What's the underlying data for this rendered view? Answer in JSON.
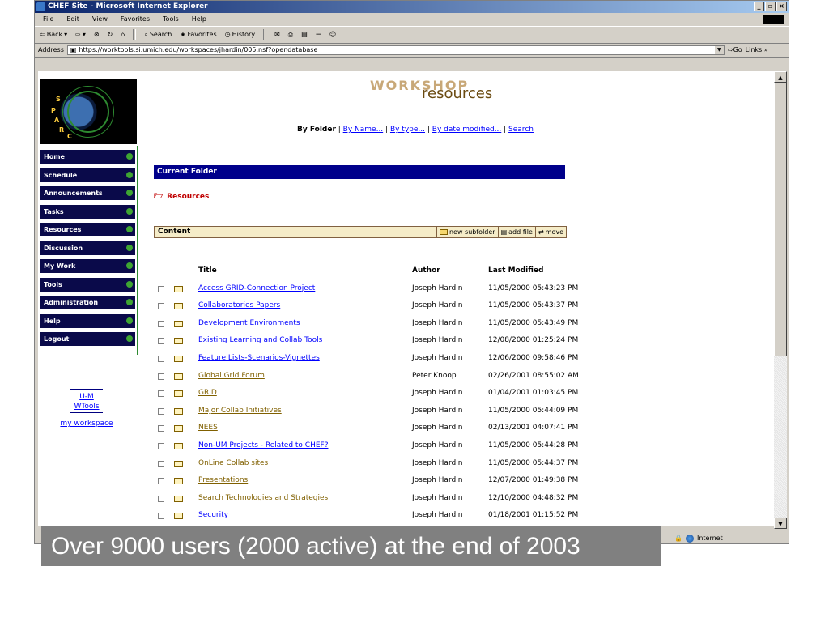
{
  "window": {
    "title": "CHEF Site - Microsoft Internet Explorer"
  },
  "menu": [
    "File",
    "Edit",
    "View",
    "Favorites",
    "Tools",
    "Help"
  ],
  "toolbar": {
    "back": "Back",
    "search": "Search",
    "favorites": "Favorites",
    "history": "History"
  },
  "address": {
    "label": "Address",
    "url": "https://worktools.si.umich.edu/workspaces/jhardin/005.nsf?opendatabase",
    "go": "Go",
    "links": "Links »"
  },
  "header": {
    "workshop": "WORKSHOP",
    "resources": "resources"
  },
  "sort": {
    "current": "By Folder",
    "by_name": "By Name...",
    "by_type": "By type...",
    "by_date": "By date modified...",
    "search": "Search"
  },
  "nav": [
    "Home",
    "Schedule",
    "Announcements",
    "Tasks",
    "Resources",
    "Discussion",
    "My Work",
    "Tools",
    "Administration",
    "Help",
    "Logout"
  ],
  "side": {
    "um": "U-M",
    "wtools": "WTools",
    "workspace": "my workspace"
  },
  "current_folder": {
    "label": "Current Folder",
    "name": "Resources"
  },
  "content": {
    "label": "Content",
    "new_subfolder": "new subfolder",
    "add_file": "add file",
    "move": "move"
  },
  "columns": {
    "title": "Title",
    "author": "Author",
    "modified": "Last Modified"
  },
  "rows": [
    {
      "title": "Access GRID-Connection Project",
      "author": "Joseph Hardin",
      "modified": "11/05/2000 05:43:23 PM"
    },
    {
      "title": "Collaboratories Papers",
      "author": "Joseph Hardin",
      "modified": "11/05/2000 05:43:37 PM"
    },
    {
      "title": "Development Environments",
      "author": "Joseph Hardin",
      "modified": "11/05/2000 05:43:49 PM"
    },
    {
      "title": "Existing Learning and Collab Tools",
      "author": "Joseph Hardin",
      "modified": "12/08/2000 01:25:24 PM"
    },
    {
      "title": "Feature Lists-Scenarios-Vignettes",
      "author": "Joseph Hardin",
      "modified": "12/06/2000 09:58:46 PM"
    },
    {
      "title": "Global Grid Forum",
      "author": "Peter Knoop",
      "modified": "02/26/2001 08:55:02 AM"
    },
    {
      "title": "GRID",
      "author": "Joseph Hardin",
      "modified": "01/04/2001 01:03:45 PM"
    },
    {
      "title": "Major Collab Initiatives",
      "author": "Joseph Hardin",
      "modified": "11/05/2000 05:44:09 PM"
    },
    {
      "title": "NEES",
      "author": "Joseph Hardin",
      "modified": "02/13/2001 04:07:41 PM"
    },
    {
      "title": "Non-UM Projects - Related to CHEF?",
      "author": "Joseph Hardin",
      "modified": "11/05/2000 05:44:28 PM"
    },
    {
      "title": "OnLine Collab sites",
      "author": "Joseph Hardin",
      "modified": "11/05/2000 05:44:37 PM"
    },
    {
      "title": "Presentations",
      "author": "Joseph Hardin",
      "modified": "12/07/2000 01:49:38 PM"
    },
    {
      "title": "Search Technologies and Strategies",
      "author": "Joseph Hardin",
      "modified": "12/10/2000 04:48:32 PM"
    },
    {
      "title": "Security",
      "author": "Joseph Hardin",
      "modified": "01/18/2001 01:15:52 PM"
    }
  ],
  "status": {
    "zone": "Internet"
  },
  "caption": "Over 9000 users (2000 active) at the end of 2003"
}
